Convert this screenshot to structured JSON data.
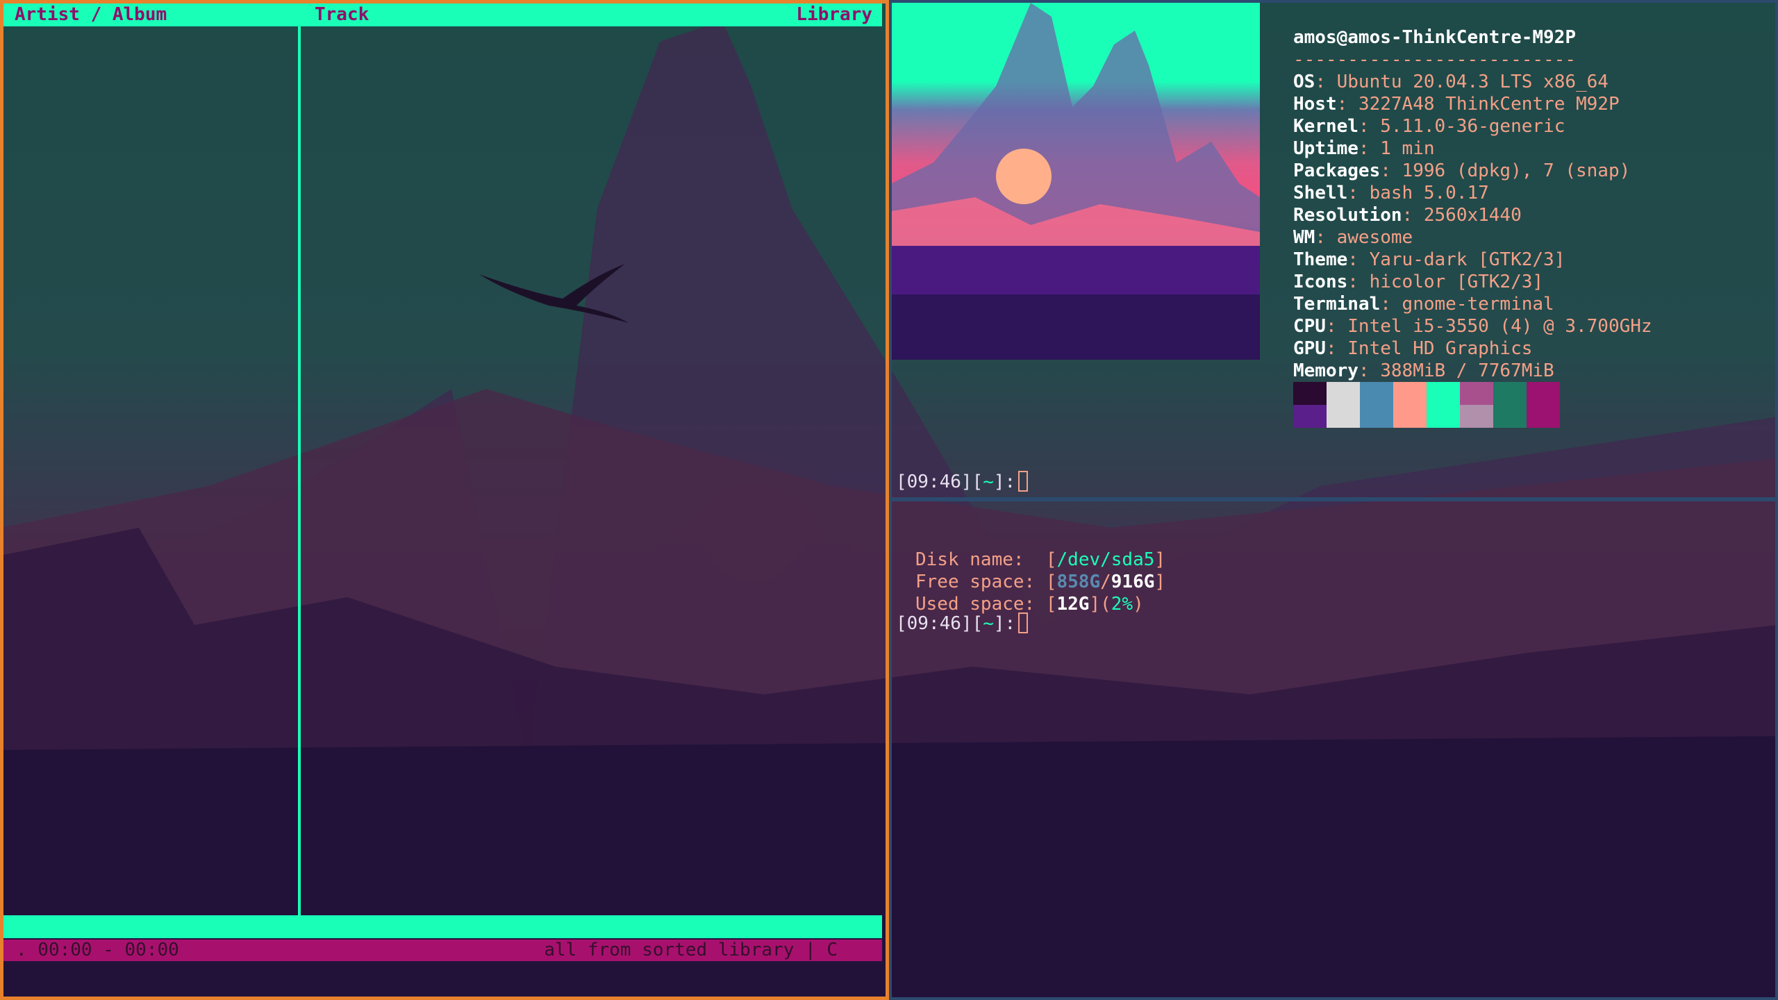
{
  "cmus": {
    "header": {
      "artist_album": "Artist / Album",
      "track": "Track",
      "library": "Library"
    },
    "status": {
      "time": ". 00:00 - 00:00",
      "mode": "all from sorted library | C"
    }
  },
  "neofetch": {
    "user_host": "amos@amos-ThinkCentre-M92P",
    "separator": "--------------------------",
    "fields": [
      {
        "label": "OS",
        "value": "Ubuntu 20.04.3 LTS x86_64"
      },
      {
        "label": "Host",
        "value": "3227A48 ThinkCentre M92P"
      },
      {
        "label": "Kernel",
        "value": "5.11.0-36-generic"
      },
      {
        "label": "Uptime",
        "value": "1 min"
      },
      {
        "label": "Packages",
        "value": "1996 (dpkg), 7 (snap)"
      },
      {
        "label": "Shell",
        "value": "bash 5.0.17"
      },
      {
        "label": "Resolution",
        "value": "2560x1440"
      },
      {
        "label": "WM",
        "value": "awesome"
      },
      {
        "label": "Theme",
        "value": "Yaru-dark [GTK2/3]"
      },
      {
        "label": "Icons",
        "value": "hicolor [GTK2/3]"
      },
      {
        "label": "Terminal",
        "value": "gnome-terminal"
      },
      {
        "label": "CPU",
        "value": "Intel i5-3550 (4) @ 3.700GHz"
      },
      {
        "label": "GPU",
        "value": "Intel HD Graphics"
      },
      {
        "label": "Memory",
        "value": "388MiB / 7767MiB"
      }
    ],
    "palette": [
      {
        "top": "#2a0a30",
        "bottom": "#5a1f8a"
      },
      {
        "top": "#d9d9d9",
        "bottom": "#d9d9d9"
      },
      {
        "top": "#4a8ab0",
        "bottom": "#4a8ab0"
      },
      {
        "top": "#ff9a8a",
        "bottom": "#ff9a8a"
      },
      {
        "top": "#1affb8",
        "bottom": "#1affb8"
      },
      {
        "top": "#a8508e",
        "bottom": "#b090aa"
      },
      {
        "top": "#1f7a64",
        "bottom": "#1f7a64"
      },
      {
        "top": "#9c1270",
        "bottom": "#9c1270"
      }
    ],
    "prompt": {
      "time": "[09:46]",
      "dir_open": "[",
      "dir": "~",
      "dir_close": "]:"
    }
  },
  "disk": {
    "name_label": "Disk name:",
    "name_value": "/dev/sda5",
    "free_label": "Free space:",
    "free_used": "858G",
    "free_total": "916G",
    "used_label": "Used space:",
    "used_value": "12G",
    "used_pct": "2%",
    "prompt": {
      "time": "[09:46]",
      "dir_open": "[",
      "dir": "~",
      "dir_close": "]:"
    }
  },
  "colors": {
    "accent": "#1affb8",
    "magenta": "#a8106e",
    "orange_border": "#e8812c",
    "text": "#f4a087"
  }
}
